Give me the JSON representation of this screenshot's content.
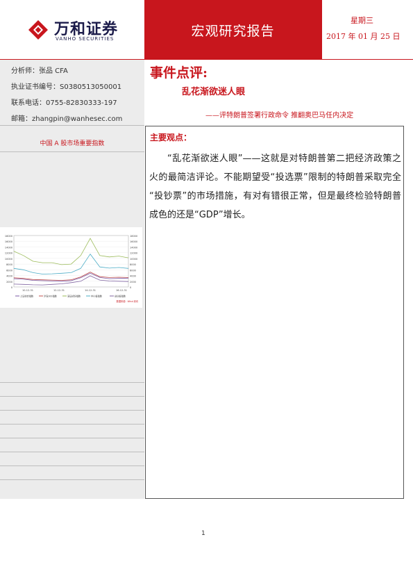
{
  "header": {
    "company_name": "万和证券",
    "company_name_en": "VANHO SECURITIES",
    "report_type": "宏观研究报告",
    "weekday": "星期三",
    "date": "2017 年 01 月 25 日"
  },
  "analyst": {
    "name_line": "分析师：张品 CFA",
    "license_line": "执业证书编号：S0380513050001",
    "phone_line": "联系电话：0755-82830333-197",
    "email_line": "邮箱：zhangpin@wanhesec.com"
  },
  "sidebar": {
    "index_heading": "中国 A 股市场重要指数"
  },
  "report": {
    "title": "事件点评:",
    "subtitle": "乱花渐欲迷人眼",
    "tagline": "——评特朗普签署行政命令 推翻奥巴马任内决定",
    "view_heading": "主要观点：",
    "view_body": "“乱花渐欲迷人眼”——这就是对特朗普第二把经济政策之火的最简洁评论。不能期望受“投选票”限制的特朗普采取完全 “投钞票”的市场措施，有对有错很正常，但是最终检验特朗普成色的还是“GDP”增长。"
  },
  "page_number": "1",
  "chart_data": {
    "type": "line",
    "title": "",
    "y_ticks_left": [
      "18000",
      "16000",
      "14000",
      "12000",
      "10000",
      "8000",
      "6000",
      "4000",
      "2000",
      "0"
    ],
    "y_ticks_right": [
      "18000",
      "16000",
      "14000",
      "12000",
      "10000",
      "8000",
      "6000",
      "4000",
      "2000",
      "0"
    ],
    "x_ticks": [
      "10-12-31",
      "12-12-31",
      "14-12-31",
      "16-12-31"
    ],
    "legend": [
      "上证综合指数",
      "沪深300指数",
      "深证成份指数",
      "中小板指数",
      "创业板指数"
    ],
    "source_note": "数据来源：Wind 资讯",
    "ylim": [
      0,
      18000
    ],
    "colors": [
      "#7b5aa6",
      "#c0504d",
      "#9bbb59",
      "#4bacc6",
      "#8064a2"
    ],
    "series": [
      {
        "name": "上证综合指数",
        "values": [
          2900,
          2700,
          2300,
          2200,
          2100,
          2000,
          2200,
          3200,
          4800,
          3300,
          2900,
          3000,
          3100
        ]
      },
      {
        "name": "沪深300指数",
        "values": [
          3200,
          3000,
          2600,
          2500,
          2400,
          2300,
          2500,
          3500,
          5200,
          3600,
          3300,
          3400,
          3300
        ]
      },
      {
        "name": "深证成份指数",
        "values": [
          12500,
          11000,
          9000,
          8500,
          8500,
          7800,
          8000,
          11000,
          17000,
          11000,
          10500,
          10800,
          10200
        ]
      },
      {
        "name": "中小板指数",
        "values": [
          6500,
          6000,
          5000,
          4500,
          4600,
          4800,
          5000,
          6500,
          11500,
          7000,
          6600,
          6800,
          6500
        ]
      },
      {
        "name": "创业板指数",
        "values": [
          1000,
          900,
          750,
          700,
          900,
          1100,
          1500,
          2000,
          3900,
          2400,
          2100,
          2000,
          1900
        ]
      }
    ]
  }
}
